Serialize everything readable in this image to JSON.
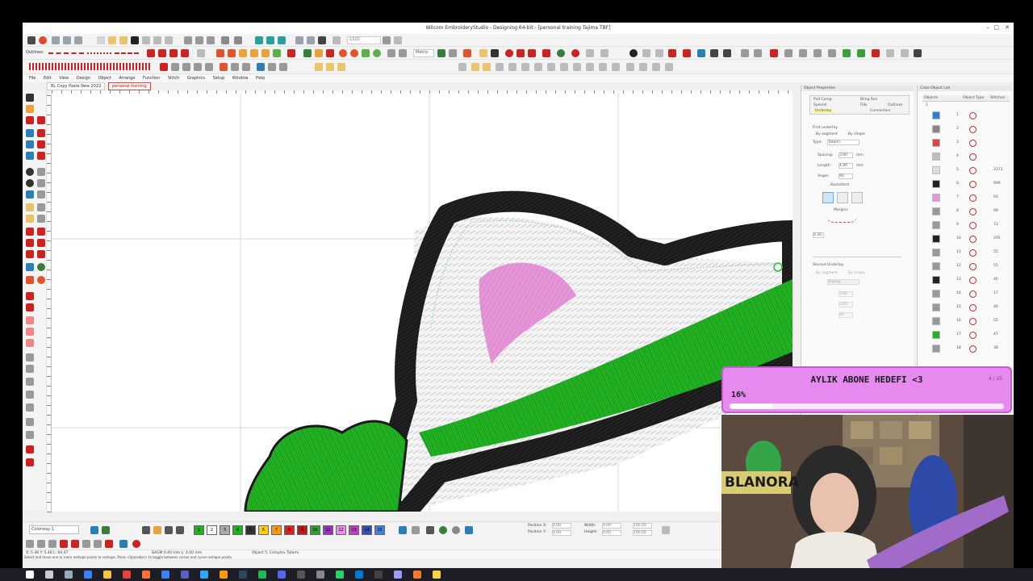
{
  "window": {
    "title": "Wilcom EmbroideryStudio - Designing 64-bit - [personal training     Tajima TBF]",
    "controls": [
      "–",
      "□",
      "✕"
    ]
  },
  "menu": [
    "File",
    "Edit",
    "View",
    "Design",
    "Object",
    "Arrange",
    "Function",
    "Stitch",
    "Graphics",
    "Setup",
    "Window",
    "Help"
  ],
  "toolbar": {
    "outlines_label": "Outlines:",
    "zoom_value": "1320",
    "units_value": "Metric"
  },
  "doc_tabs": [
    {
      "label": "BL Copy Paste New 2022",
      "active": false
    },
    {
      "label": "personal training",
      "active": true
    }
  ],
  "object_properties": {
    "title": "Object Properties",
    "tabs": [
      "Pull Comp",
      "Bling Run",
      "Special",
      "Fills",
      "Underlay",
      "Connectors",
      "Outlines"
    ],
    "first_underlay": "First underlay",
    "by_segment": "By segment",
    "by_shape": "By shape",
    "type_label": "Type:",
    "type_value": "Tatami",
    "spacing_label": "Spacing:",
    "spacing_value": "3.00",
    "length_label": "Length:",
    "length_value": "4.00",
    "angle_label": "Angle:",
    "angle_value": "90",
    "backstitch": "Backstitch",
    "margins": "Margins",
    "margin_value": "0.20",
    "unit": "mm",
    "second_underlay": "Second Underlay",
    "second_type": "Zigzag",
    "spacing2_value": "3.00",
    "length2_value": "3.00",
    "angle2_value": "90"
  },
  "color_object_list": {
    "title": "Color-Object List",
    "col_objects": "Objects",
    "col_type": "Object Type",
    "col_stitches": "Stitches",
    "top_value": "1",
    "rows": [
      {
        "num": "1",
        "stitches": ""
      },
      {
        "num": "2",
        "stitches": ""
      },
      {
        "num": "3",
        "stitches": ""
      },
      {
        "num": "4",
        "stitches": ""
      },
      {
        "num": "5",
        "stitches": "2373"
      },
      {
        "num": "6",
        "stitches": "999"
      },
      {
        "num": "7",
        "stitches": "93"
      },
      {
        "num": "8",
        "stitches": "99"
      },
      {
        "num": "9",
        "stitches": "73"
      },
      {
        "num": "10",
        "stitches": "295"
      },
      {
        "num": "11",
        "stitches": "55"
      },
      {
        "num": "12",
        "stitches": "55"
      },
      {
        "num": "13",
        "stitches": "46"
      },
      {
        "num": "14",
        "stitches": "17"
      },
      {
        "num": "15",
        "stitches": "46"
      },
      {
        "num": "16",
        "stitches": "55"
      },
      {
        "num": "17",
        "stitches": "47"
      },
      {
        "num": "18",
        "stitches": "38"
      }
    ]
  },
  "bottom": {
    "colorway": "Colorway 1",
    "swatches": [
      {
        "label": "1",
        "color": "#1cb31c"
      },
      {
        "label": "2",
        "color": "#ffffff"
      },
      {
        "label": "3",
        "color": "#aaaaaa"
      },
      {
        "label": "4",
        "color": "#1cb31c"
      },
      {
        "label": "5",
        "color": "#333333"
      },
      {
        "label": "6",
        "color": "#ffd000"
      },
      {
        "label": "7",
        "color": "#ff9900"
      },
      {
        "label": "8",
        "color": "#e02020"
      },
      {
        "label": "9",
        "color": "#c01818"
      },
      {
        "label": "10",
        "color": "#30a030"
      },
      {
        "label": "11",
        "color": "#9b30c9"
      },
      {
        "label": "12",
        "color": "#f08af0"
      },
      {
        "label": "13",
        "color": "#c040c0"
      },
      {
        "label": "14",
        "color": "#3050c0"
      },
      {
        "label": "15",
        "color": "#4080e0"
      }
    ],
    "pos_x_label": "Position X:",
    "pos_y_label": "Position Y:",
    "pos_x": "0.00",
    "pos_y": "0.00",
    "width_label": "Width:",
    "height_label": "Height:",
    "width": "0.00",
    "height": "0.00",
    "scale_w": "100.00",
    "scale_h": "100.00"
  },
  "status": {
    "coords": "X: 5.48   Y: 5.48   L: 64.47",
    "info": "BAGM  0.40 mm L: 4.00 mm",
    "object": "Object 5: Complex Tatami",
    "hint": "Select and move one or more reshape points to reshape. Press <Spacebar> to toggle between corner and curve reshape points."
  },
  "overlay": {
    "goal_title": "AYLIK ABONE HEDEFI <3",
    "goal_percent": "16%",
    "goal_progress": 0.16,
    "goal_count": "4 / 25"
  },
  "webcam": {
    "sign_text": "BLANORA"
  },
  "colors": {
    "accent_pink": "#e78af0",
    "stitch_black": "#1a1a1a",
    "stitch_green": "#22b423",
    "stitch_pink": "#e594d8",
    "stitch_white": "#eeeeee"
  },
  "taskbar_icons": [
    "windows-start",
    "search",
    "task-view",
    "edge",
    "explorer",
    "chrome",
    "firefox",
    "mail",
    "teams",
    "photoshop",
    "illustrator",
    "steam",
    "spotify",
    "discord",
    "obs",
    "settings",
    "whatsapp",
    "store",
    "terminal",
    "premiere",
    "blender",
    "notes"
  ]
}
